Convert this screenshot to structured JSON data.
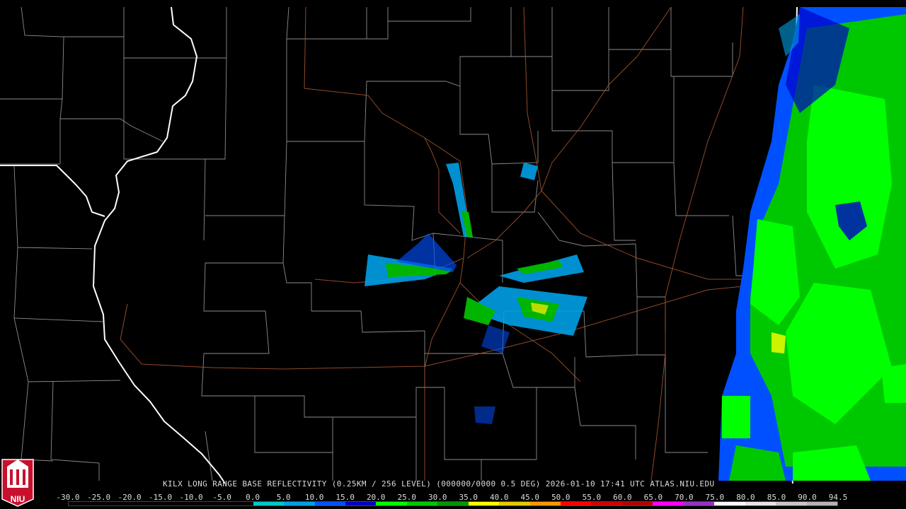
{
  "product_caption": "KILX LONG RANGE BASE REFLECTIVITY (0.25KM / 256 LEVEL) (000000/0000 0.5 DEG) 2026-01-10 17:41 UTC  ATLAS.NIU.EDU",
  "logo_text": "NIU",
  "colorbar": {
    "tick_labels": [
      "-30.0",
      "-25.0",
      "-20.0",
      "-15.0",
      "-10.0",
      "-5.0",
      "0.0",
      "5.0",
      "10.0",
      "15.0",
      "20.0",
      "25.0",
      "30.0",
      "35.0",
      "40.0",
      "45.0",
      "50.0",
      "55.0",
      "60.0",
      "65.0",
      "70.0",
      "75.0",
      "80.0",
      "85.0",
      "90.0",
      "94.5"
    ],
    "colors": [
      "#000000",
      "#000000",
      "#000000",
      "#000000",
      "#000000",
      "#000000",
      "#00c8c8",
      "#00a0e6",
      "#0050ff",
      "#0000c8",
      "#00ff00",
      "#00c800",
      "#009600",
      "#ffff00",
      "#e6c800",
      "#ff9600",
      "#ff0000",
      "#d20000",
      "#b40000",
      "#ff00ff",
      "#9632c8",
      "#ffffff",
      "#e6e6e6",
      "#c8c8c8",
      "#b4b4b4"
    ]
  },
  "colors": {
    "county_lines": "#9a9a9a",
    "state_lines": "#ffffff",
    "highways": "#a0522d",
    "background": "#000000",
    "logo_red": "#c8102e"
  }
}
